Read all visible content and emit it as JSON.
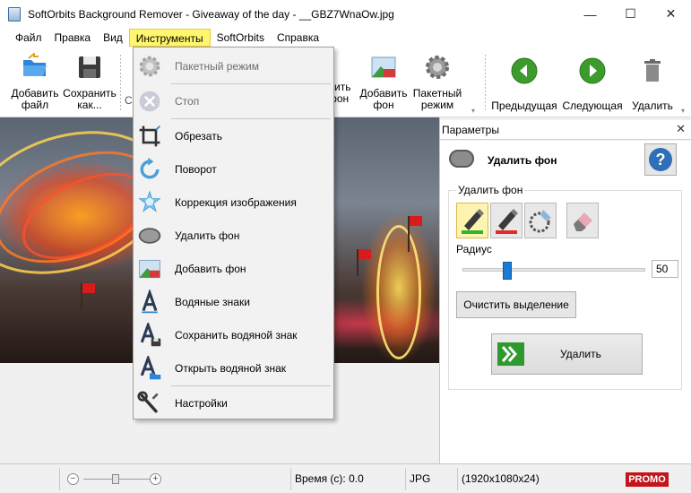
{
  "window": {
    "title": "SoftOrbits Background Remover - Giveaway of the day - __GBZ7WnaOw.jpg",
    "minimize_glyph": "—",
    "maximize_glyph": "☐",
    "close_glyph": "✕"
  },
  "menu": {
    "items": [
      "Файл",
      "Правка",
      "Вид",
      "Инструменты",
      "SoftOrbits",
      "Справка"
    ],
    "active": "Инструменты"
  },
  "toolbar": {
    "add_file": "Добавить файл",
    "save_as": "Сохранить как...",
    "hidden_partial_1": "С",
    "remove_bg_partial": "лить фон",
    "add_bg": "Добавить фон",
    "batch": "Пакетный режим",
    "prev": "Предыдущая",
    "next": "Следующая",
    "delete": "Удалить"
  },
  "dropdown": {
    "items": [
      {
        "label": "Пакетный режим",
        "icon": "gear-icon",
        "disabled": true
      },
      {
        "label": "Стоп",
        "icon": "stop-icon",
        "disabled": true
      },
      {
        "label": "Обрезать",
        "icon": "crop-icon",
        "disabled": false
      },
      {
        "label": "Поворот",
        "icon": "rotate-icon",
        "disabled": false
      },
      {
        "label": "Коррекция изображения",
        "icon": "image-correction-icon",
        "disabled": false
      },
      {
        "label": "Удалить фон",
        "icon": "remove-background-icon",
        "disabled": false
      },
      {
        "label": "Добавить фон",
        "icon": "add-background-icon",
        "disabled": false
      },
      {
        "label": "Водяные знаки",
        "icon": "watermark-icon",
        "disabled": false
      },
      {
        "label": "Сохранить водяной знак",
        "icon": "save-watermark-icon",
        "disabled": false
      },
      {
        "label": "Открыть водяной знак",
        "icon": "open-watermark-icon",
        "disabled": false
      },
      {
        "label": "Настройки",
        "icon": "settings-wrench-icon",
        "disabled": false
      }
    ]
  },
  "panel": {
    "title": "Параметры",
    "close_glyph": "✕",
    "section_title": "Удалить фон",
    "help_glyph": "?",
    "group_label": "Удалить фон",
    "radius_label": "Радиус",
    "radius_value": "50",
    "radius_min": 0,
    "radius_max": 500,
    "clear_selection": "Очистить выделение",
    "remove": "Удалить"
  },
  "status": {
    "zoom_minus": "−",
    "zoom_plus": "+",
    "time": "Время (с): 0.0",
    "format": "JPG",
    "dimensions": "(1920x1080x24)",
    "promo": "PROMO"
  },
  "colors": {
    "menu_highlight": "#fff66d",
    "promo": "#c4151c",
    "slider": "#1a7ad4",
    "help": "#2f6fb8"
  }
}
